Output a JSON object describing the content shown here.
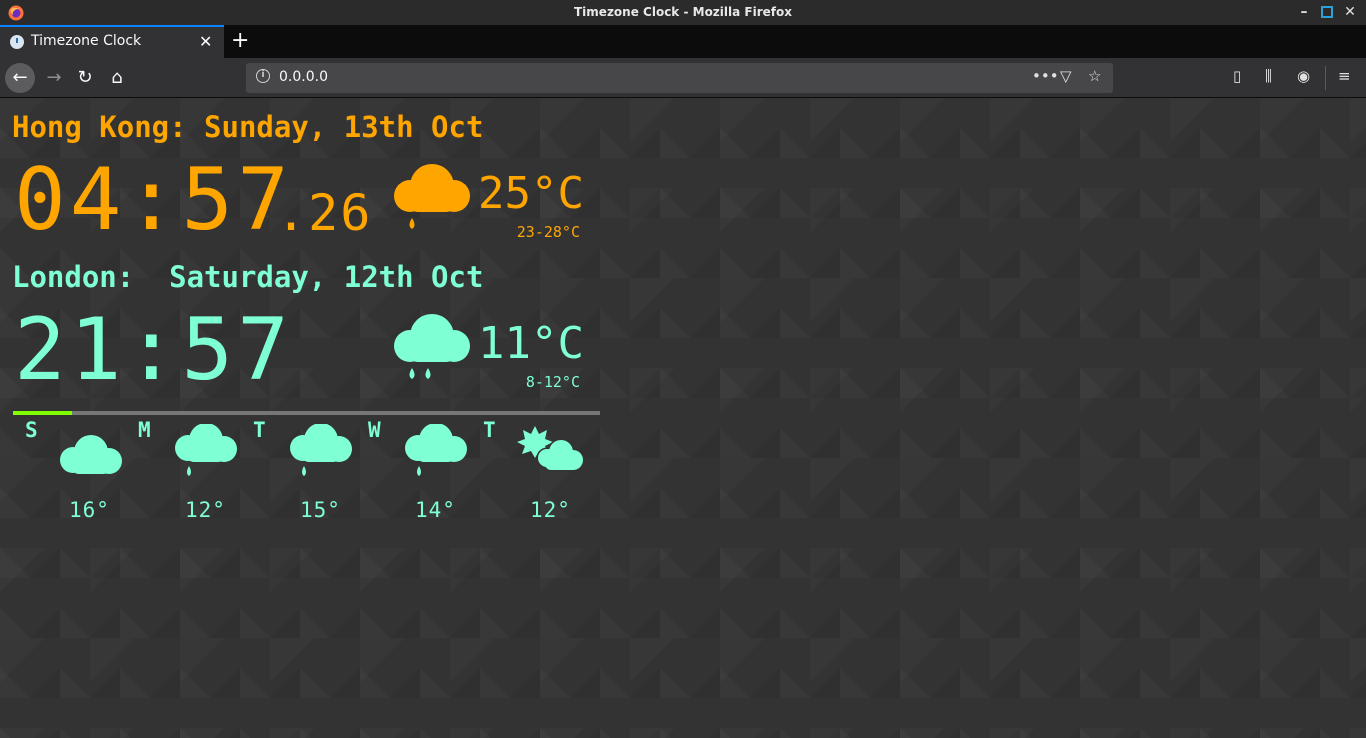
{
  "window": {
    "title": "Timezone Clock - Mozilla Firefox",
    "min_glyph": "–",
    "close_glyph": "✕"
  },
  "tab": {
    "label": "Timezone Clock",
    "close_glyph": "✕",
    "newtab_glyph": "+"
  },
  "nav": {
    "back_glyph": "←",
    "forward_glyph": "→",
    "reload_glyph": "↻",
    "home_glyph": "⌂",
    "url": "0.0.0.0",
    "info_glyph": "i",
    "more_glyph": "•••",
    "pocket_glyph": "▽",
    "star_glyph": "☆",
    "sidebar_glyph": "▯",
    "library_glyph": "⫼",
    "account_glyph": "◉",
    "menu_glyph": "≡"
  },
  "clocks": {
    "hk": {
      "label": "Hong Kong: Sunday, 13th Oct",
      "time": "04:57",
      "seconds": ".26",
      "temp": "25°C",
      "range": "23-28°C",
      "icon": "rain-cloud-icon",
      "color": "#ffa500"
    },
    "london": {
      "label": "London:  Saturday, 12th Oct",
      "time": "21:57",
      "temp": "11°C",
      "range": "8-12°C",
      "icon": "rain-cloud-icon",
      "color": "#7fffd4"
    }
  },
  "progress": {
    "fraction": 0.1,
    "fill_color": "#7fff00"
  },
  "forecast": [
    {
      "day": "S",
      "temp": "16°",
      "icon": "cloud-icon"
    },
    {
      "day": "M",
      "temp": "12°",
      "icon": "light-rain-cloud-icon"
    },
    {
      "day": "T",
      "temp": "15°",
      "icon": "light-rain-cloud-icon"
    },
    {
      "day": "W",
      "temp": "14°",
      "icon": "light-rain-cloud-icon"
    },
    {
      "day": "T",
      "temp": "12°",
      "icon": "partly-sunny-icon"
    }
  ]
}
